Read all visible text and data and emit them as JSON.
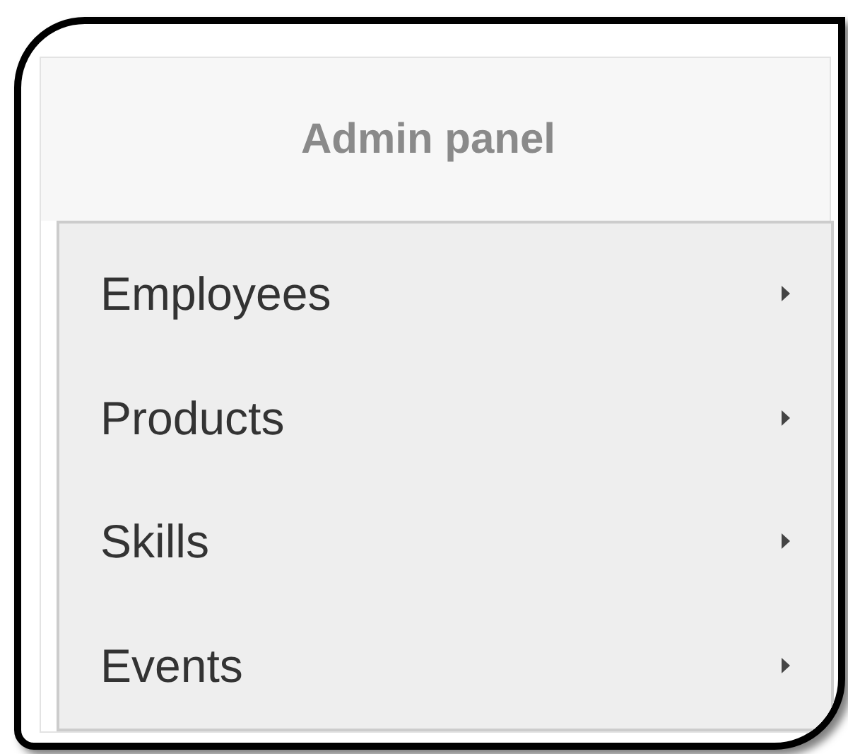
{
  "header": {
    "title": "Admin panel"
  },
  "menu": {
    "items": [
      {
        "label": "Employees",
        "has_submenu": true
      },
      {
        "label": "Products",
        "has_submenu": true
      },
      {
        "label": "Skills",
        "has_submenu": true
      },
      {
        "label": "Events",
        "has_submenu": true
      }
    ]
  }
}
